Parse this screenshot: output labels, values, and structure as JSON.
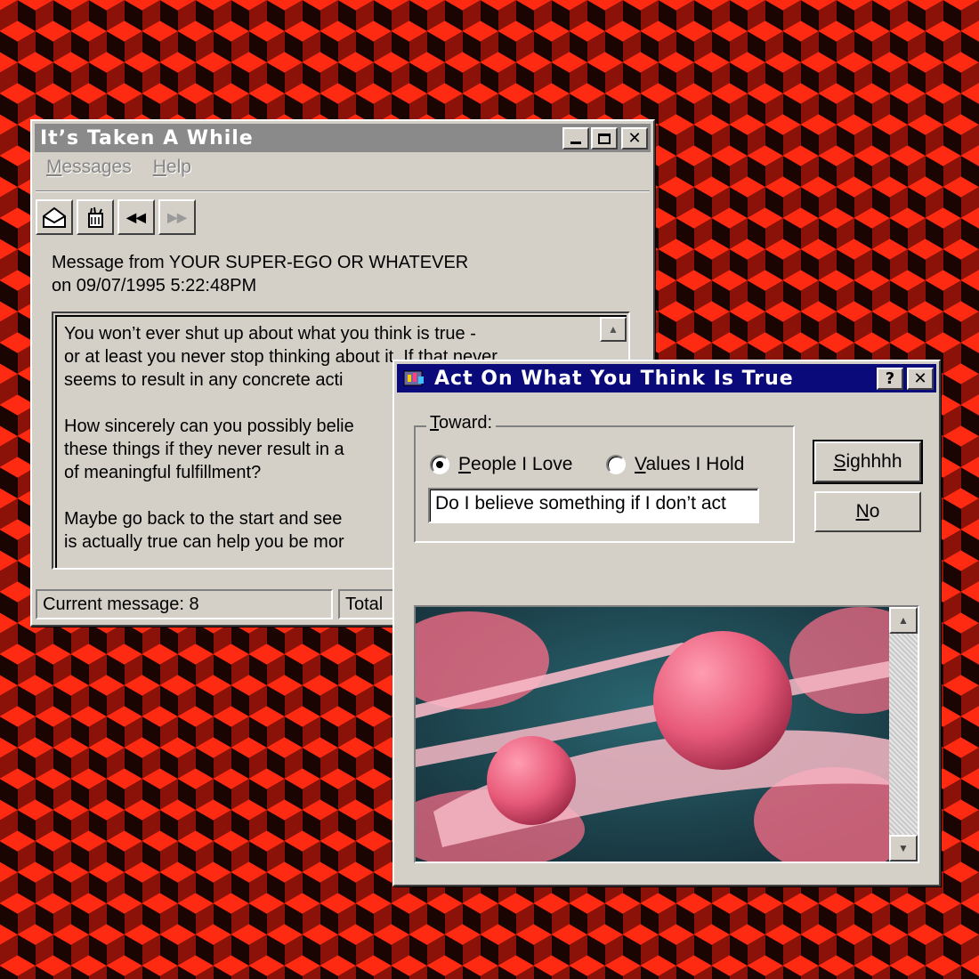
{
  "messages_window": {
    "title": "It’s Taken A While",
    "menu": [
      {
        "label_u": "M",
        "label_rest": "essages"
      },
      {
        "label_u": "H",
        "label_rest": "elp"
      }
    ],
    "toolbar_icons": [
      "open-envelope-icon",
      "trash-icon",
      "previous-icon",
      "next-icon"
    ],
    "header_line1": "Message from YOUR SUPER-EGO OR WHATEVER",
    "header_line2": "on 09/07/1995 5:22:48PM",
    "paragraphs": [
      "You won’t ever shut up about what you think is true -\nor at least you never stop thinking about it. If that never\nseems to result in any concrete acti",
      "How sincerely can you possibly belie\nthese things if they never result in a\nof meaningful fulfillment?",
      "Maybe go back to the start and see\nis actually true can help you be mor"
    ],
    "status_current": "Current message: 8",
    "status_total": "Total"
  },
  "dialog": {
    "title": "Act On What You Think Is True",
    "help_label": "?",
    "close_label": "✕",
    "group_label_u": "T",
    "group_label_rest": "oward:",
    "radio1_u": "P",
    "radio1_rest": "eople I Love",
    "radio1_selected": true,
    "radio2_u": "V",
    "radio2_rest": "alues I Hold",
    "input_value": "Do I believe something if I don’t act",
    "button1_u": "S",
    "button1_rest": "ighhhh",
    "button2_u": "N",
    "button2_rest": "o",
    "image_icon": "pink-spheres-picture"
  },
  "colors": {
    "dialog_title_active": "#0a0a7a",
    "window_title_inactive": "#8a8a8a",
    "background_red": "#ff2a12",
    "face": "#d4d0c8"
  }
}
